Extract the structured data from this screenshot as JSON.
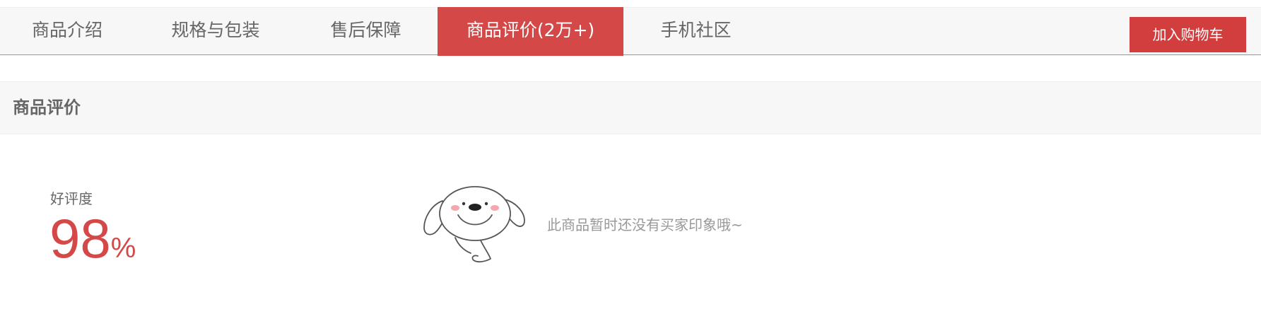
{
  "tabs": [
    {
      "label": "商品介绍",
      "active": false
    },
    {
      "label": "规格与包装",
      "active": false
    },
    {
      "label": "售后保障",
      "active": false
    },
    {
      "label": "商品评价(2万+)",
      "active": true
    },
    {
      "label": "手机社区",
      "active": false
    }
  ],
  "cart_button": {
    "label": "加入购物车"
  },
  "section": {
    "title": "商品评价"
  },
  "rating": {
    "label": "好评度",
    "value": "98",
    "unit": "%"
  },
  "empty_state": {
    "text": "此商品暂时还没有买家印象哦~",
    "icon": "jd-dog-mascot-icon"
  },
  "colors": {
    "accent": "#d44848",
    "button": "#d23d3d",
    "tabbar_bg": "#f7f7f7"
  }
}
